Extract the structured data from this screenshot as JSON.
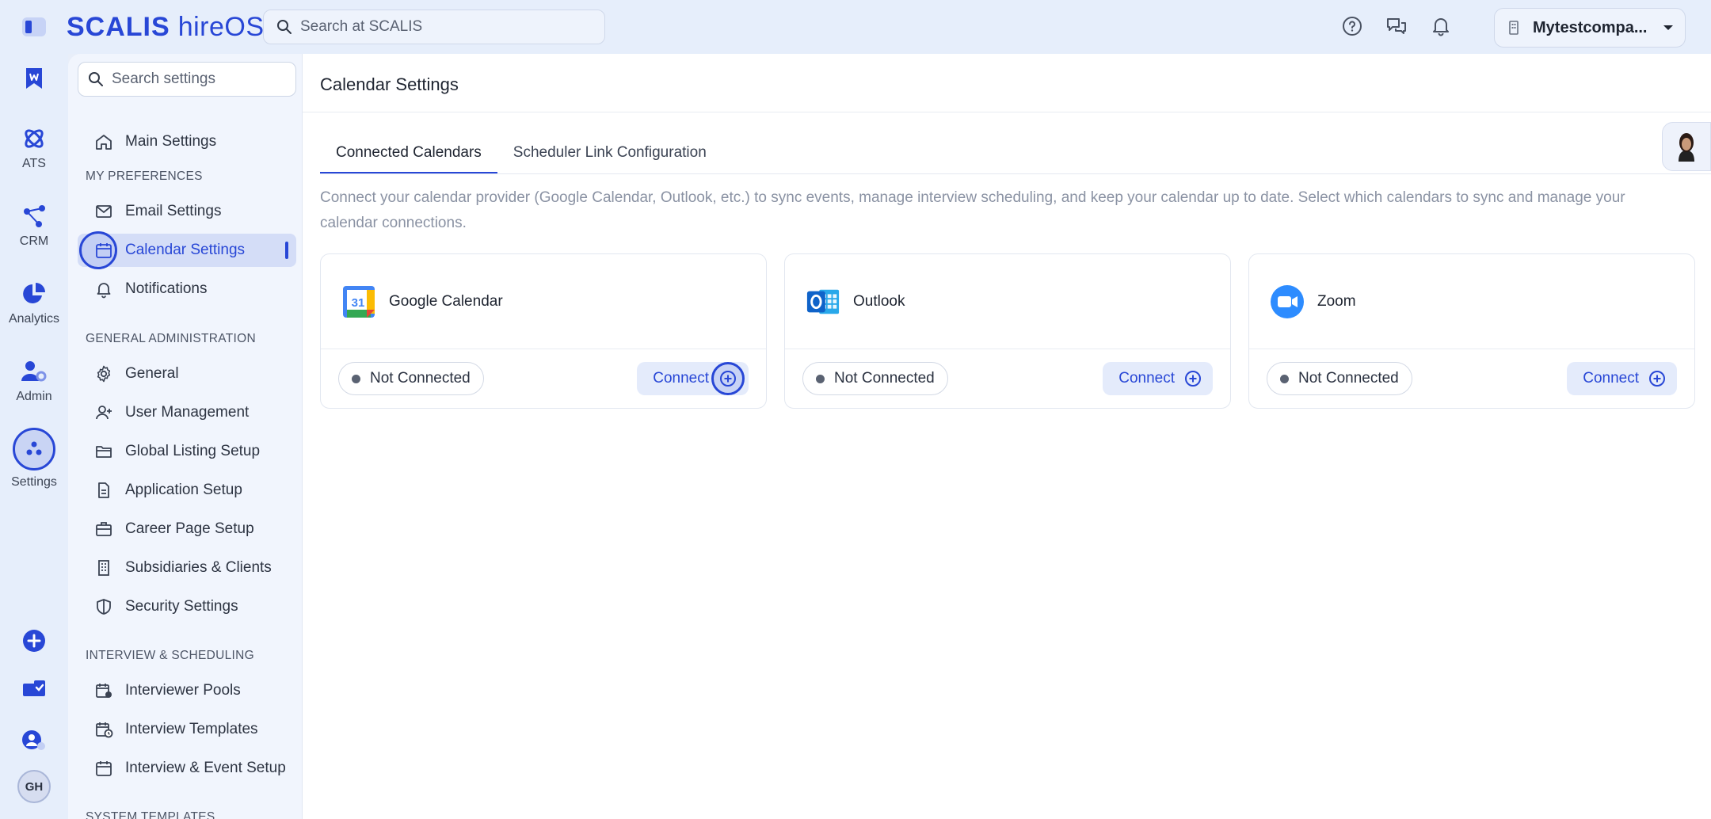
{
  "app": {
    "brand": "SCALIS",
    "product": "hireOS",
    "search_placeholder": "Search at SCALIS",
    "company": "Mytestcompa...",
    "user_initials": "GH"
  },
  "rail": {
    "items": [
      {
        "label": "",
        "icon": "bookmark-icon"
      },
      {
        "label": "ATS",
        "icon": "atom-icon"
      },
      {
        "label": "CRM",
        "icon": "network-icon"
      },
      {
        "label": "Analytics",
        "icon": "pie-chart-icon"
      },
      {
        "label": "Admin",
        "icon": "user-gear-icon"
      },
      {
        "label": "Settings",
        "icon": "settings-dots-icon"
      }
    ],
    "bottom": [
      "add-circle-icon",
      "mail-check-icon",
      "user-switch-icon"
    ]
  },
  "settings_nav": {
    "search_placeholder": "Search settings",
    "main": "Main Settings",
    "sections": {
      "my_preferences": "MY PREFERENCES",
      "general_admin": "GENERAL ADMINISTRATION",
      "interview": "INTERVIEW & SCHEDULING",
      "system_templates": "SYSTEM TEMPLATES"
    },
    "items": {
      "email": "Email Settings",
      "calendar": "Calendar Settings",
      "notifications": "Notifications",
      "general": "General",
      "user_mgmt": "User Management",
      "global_listing": "Global Listing Setup",
      "application": "Application Setup",
      "career_page": "Career Page Setup",
      "subsidiaries": "Subsidiaries & Clients",
      "security": "Security Settings",
      "interviewer_pools": "Interviewer Pools",
      "interview_templates": "Interview Templates",
      "event_setup": "Interview & Event Setup"
    }
  },
  "page": {
    "title": "Calendar Settings",
    "tabs": [
      "Connected Calendars",
      "Scheduler Link Configuration"
    ],
    "description": "Connect your calendar provider (Google Calendar, Outlook, etc.) to sync events, manage interview scheduling, and keep your calendar up to date. Select which calendars to sync and manage your calendar connections.",
    "cards": [
      {
        "name": "Google Calendar",
        "status": "Not Connected",
        "action": "Connect"
      },
      {
        "name": "Outlook",
        "status": "Not Connected",
        "action": "Connect"
      },
      {
        "name": "Zoom",
        "status": "Not Connected",
        "action": "Connect"
      }
    ]
  },
  "colors": {
    "accent": "#2847d6",
    "rail_bg": "#e6eefb",
    "nav_bg": "#f1f5fd",
    "active_bg": "#d4ddf7"
  }
}
